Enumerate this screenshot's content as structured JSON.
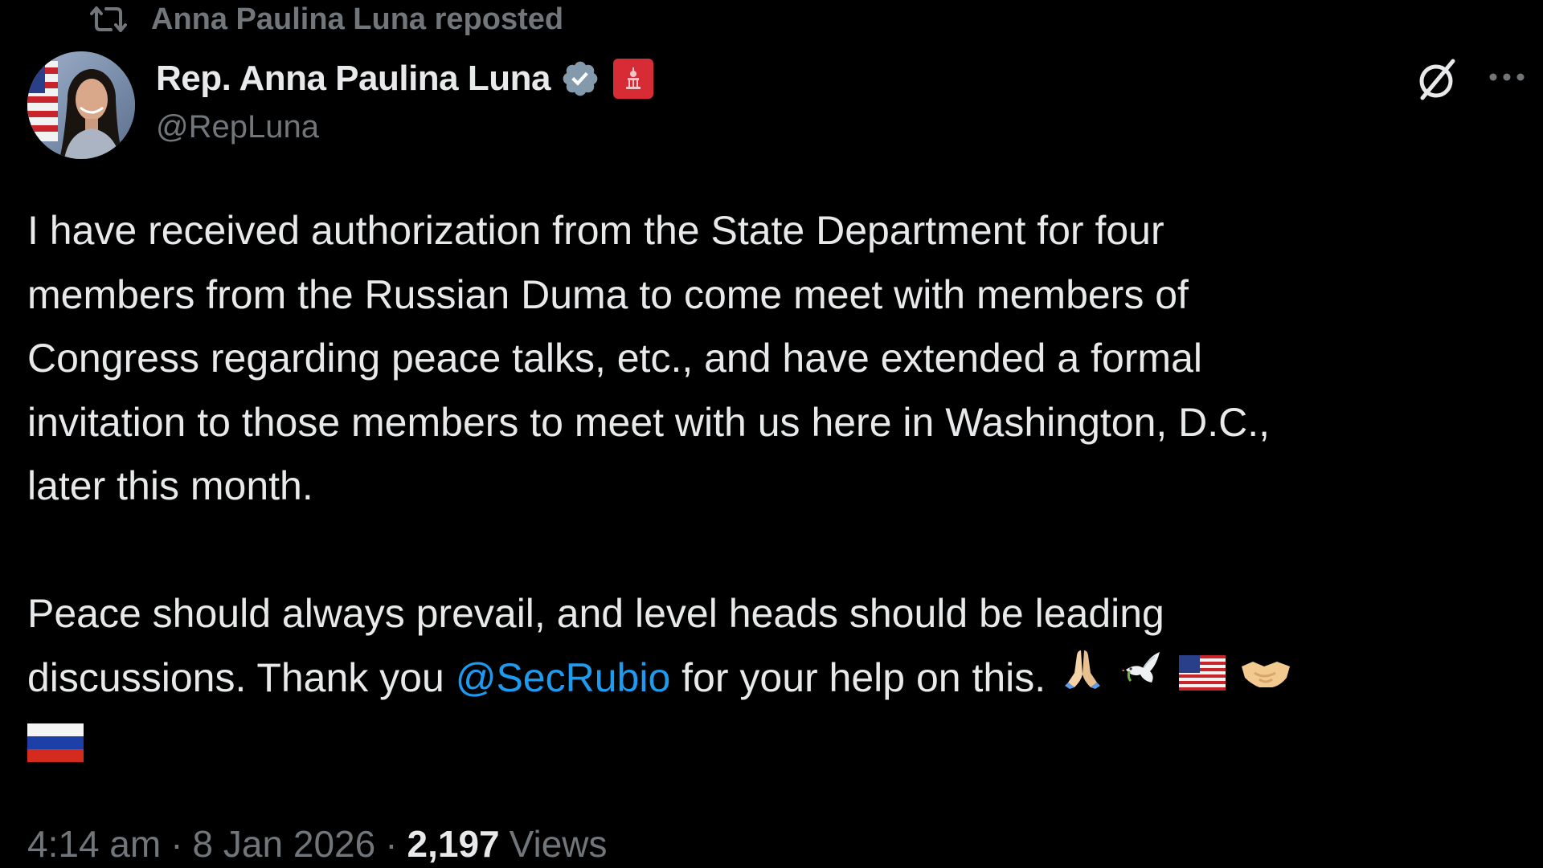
{
  "repost": {
    "icon": "repost-icon",
    "text": "Anna Paulina Luna reposted"
  },
  "author": {
    "display_name": "Rep. Anna Paulina Luna",
    "handle": "@RepLuna",
    "verified_icon": "verified-badge-icon",
    "affiliation_icon": "us-house-badge-icon",
    "verified_color": "#829aab",
    "badge_color": "#d72b36"
  },
  "actions": {
    "grok_icon": "grok-icon",
    "more_icon": "more-options-icon"
  },
  "tweet": {
    "lines": [
      "I have received authorization from the State Department for four",
      "members from the Russian Duma to come meet with members of",
      "Congress regarding peace talks, etc., and have extended a formal",
      "invitation to those members to meet with us here in Washington, D.C.,",
      "later this month."
    ],
    "line6": "Peace should always prevail, and level heads should be leading",
    "line7_prefix": "discussions. Thank you ",
    "mention": "@SecRubio",
    "line7_suffix": " for your help on this.",
    "emojis": [
      "folded-hands-emoji",
      "dove-emoji",
      "us-flag-emoji",
      "handshake-emoji",
      "russia-flag-emoji"
    ]
  },
  "meta": {
    "time": "4:14 am",
    "separator": "·",
    "date": "8 Jan 2026",
    "views_count": "2,197",
    "views_label": "Views"
  },
  "colors": {
    "background": "#000000",
    "text_primary": "#e7e9ea",
    "text_secondary": "#71767b",
    "link": "#1d9bf0"
  }
}
